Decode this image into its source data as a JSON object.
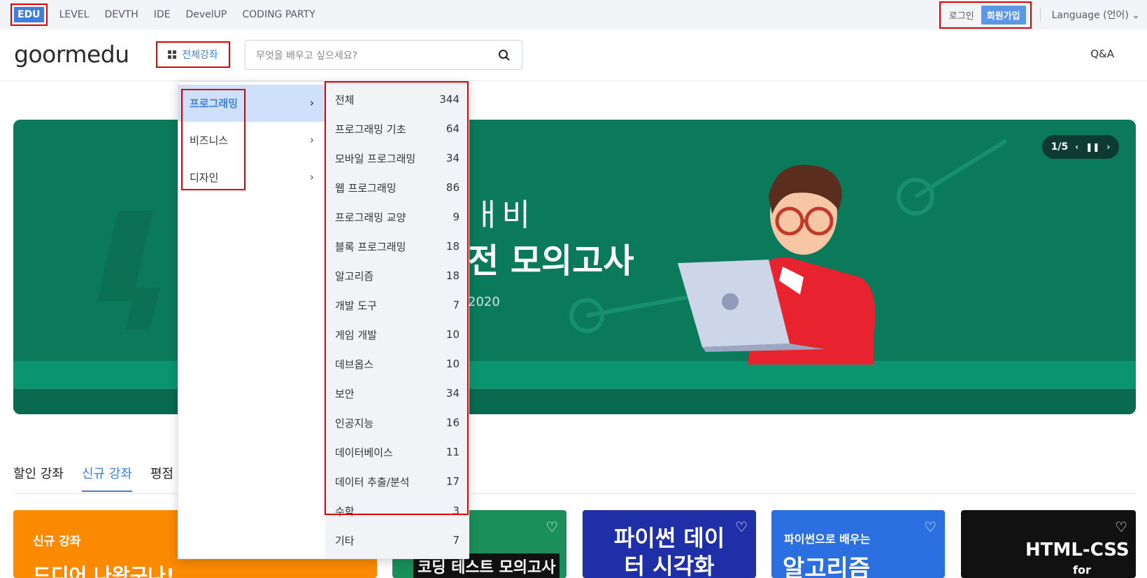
{
  "topbar": {
    "services": [
      "EDU",
      "LEVEL",
      "DEVTH",
      "IDE",
      "DevelUP",
      "CODING PARTY"
    ],
    "login": "로그인",
    "signup": "회원가입",
    "language": "Language (언어) ⌄"
  },
  "header": {
    "logo": "goormedu",
    "all_courses": "전체강좌",
    "search_placeholder": "무엇을 배우고 싶으세요?",
    "qa": "Q&A"
  },
  "banner": {
    "line1": "ㅐ비",
    "line2": "전 모의고사",
    "year": "2020",
    "pager": "1/5",
    "bg_color": "#0a7a5a"
  },
  "tabs": [
    "할인 강좌",
    "신규 강좌",
    "평점"
  ],
  "cards": {
    "c1_tag": "신규 강좌",
    "c1_title": "드디어 나왔구나!",
    "c2_title": "코딩 테스트 모의고사",
    "c3_title": "파이썬 데이터 시각화",
    "c4_sub": "파이썬으로 배우는",
    "c4_title": "알고리즘",
    "c5_title": "HTML-CSS",
    "c5_sub": "for newbie"
  },
  "menu": {
    "categories": [
      {
        "label": "프로그래밍",
        "active": true
      },
      {
        "label": "비즈니스",
        "active": false
      },
      {
        "label": "디자인",
        "active": false
      }
    ],
    "subcategories": [
      {
        "label": "전체",
        "count": "344"
      },
      {
        "label": "프로그래밍 기초",
        "count": "64"
      },
      {
        "label": "모바일 프로그래밍",
        "count": "34"
      },
      {
        "label": "웹 프로그래밍",
        "count": "86"
      },
      {
        "label": "프로그래밍 교양",
        "count": "9"
      },
      {
        "label": "블록 프로그래밍",
        "count": "18"
      },
      {
        "label": "알고리즘",
        "count": "18"
      },
      {
        "label": "개발 도구",
        "count": "7"
      },
      {
        "label": "게임 개발",
        "count": "10"
      },
      {
        "label": "데브옵스",
        "count": "10"
      },
      {
        "label": "보안",
        "count": "34"
      },
      {
        "label": "인공지능",
        "count": "16"
      },
      {
        "label": "데이터베이스",
        "count": "11"
      },
      {
        "label": "데이터 추출/분석",
        "count": "17"
      },
      {
        "label": "수학",
        "count": "3"
      },
      {
        "label": "기타",
        "count": "7"
      }
    ]
  }
}
